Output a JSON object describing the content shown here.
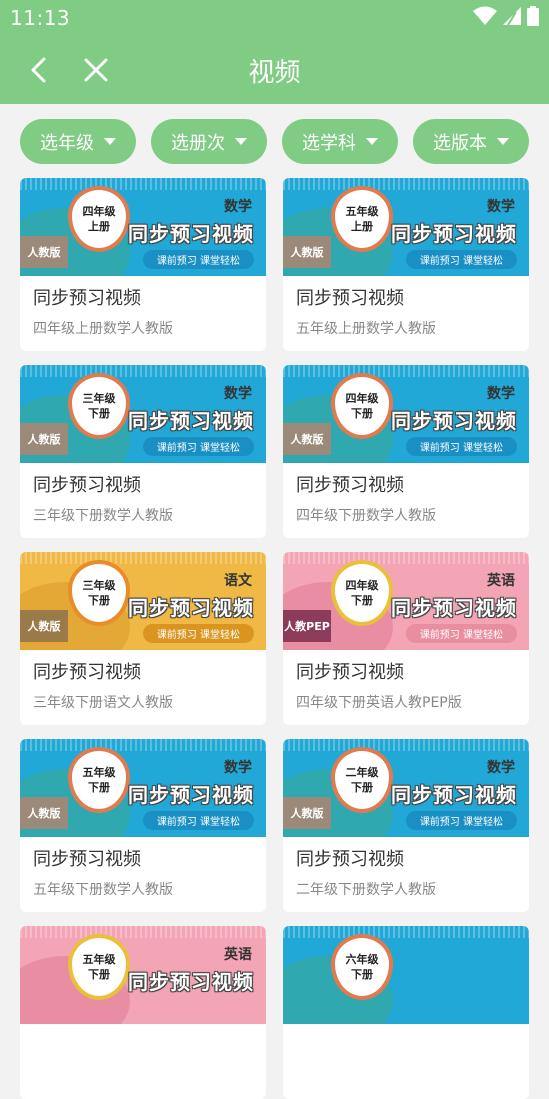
{
  "status": {
    "time": "11:13"
  },
  "header": {
    "title": "视频"
  },
  "filters": [
    {
      "label": "选年级"
    },
    {
      "label": "选册次"
    },
    {
      "label": "选学科"
    },
    {
      "label": "选版本"
    }
  ],
  "videos": [
    {
      "theme": "blue",
      "badge_line1": "四年级",
      "badge_line2": "上册",
      "subject": "数学",
      "headline": "同步预习视频",
      "slogan": "课前预习 课堂轻松",
      "edition": "人教版",
      "title": "同步预习视频",
      "subtitle": "四年级上册数学人教版"
    },
    {
      "theme": "blue",
      "badge_line1": "五年级",
      "badge_line2": "上册",
      "subject": "数学",
      "headline": "同步预习视频",
      "slogan": "课前预习 课堂轻松",
      "edition": "人教版",
      "title": "同步预习视频",
      "subtitle": "五年级上册数学人教版"
    },
    {
      "theme": "blue",
      "badge_line1": "三年级",
      "badge_line2": "下册",
      "subject": "数学",
      "headline": "同步预习视频",
      "slogan": "课前预习 课堂轻松",
      "edition": "人教版",
      "title": "同步预习视频",
      "subtitle": "三年级下册数学人教版"
    },
    {
      "theme": "blue",
      "badge_line1": "四年级",
      "badge_line2": "下册",
      "subject": "数学",
      "headline": "同步预习视频",
      "slogan": "课前预习 课堂轻松",
      "edition": "人教版",
      "title": "同步预习视频",
      "subtitle": "四年级下册数学人教版"
    },
    {
      "theme": "yellow",
      "badge_line1": "三年级",
      "badge_line2": "下册",
      "subject": "语文",
      "headline": "同步预习视频",
      "slogan": "课前预习 课堂轻松",
      "edition": "人教版",
      "title": "同步预习视频",
      "subtitle": "三年级下册语文人教版"
    },
    {
      "theme": "pink",
      "badge_line1": "四年级",
      "badge_line2": "下册",
      "subject": "英语",
      "headline": "同步预习视频",
      "slogan": "课前预习 课堂轻松",
      "edition": "人教PEP",
      "title": "同步预习视频",
      "subtitle": "四年级下册英语人教PEP版"
    },
    {
      "theme": "blue",
      "badge_line1": "五年级",
      "badge_line2": "下册",
      "subject": "数学",
      "headline": "同步预习视频",
      "slogan": "课前预习 课堂轻松",
      "edition": "人教版",
      "title": "同步预习视频",
      "subtitle": "五年级下册数学人教版"
    },
    {
      "theme": "blue",
      "badge_line1": "二年级",
      "badge_line2": "下册",
      "subject": "数学",
      "headline": "同步预习视频",
      "slogan": "课前预习 课堂轻松",
      "edition": "人教版",
      "title": "同步预习视频",
      "subtitle": "二年级下册数学人教版"
    },
    {
      "theme": "pink",
      "badge_line1": "五年级",
      "badge_line2": "下册",
      "subject": "英语",
      "headline": "同步预习视频",
      "slogan": "",
      "edition": "",
      "title": "",
      "subtitle": ""
    },
    {
      "theme": "blue",
      "badge_line1": "六年级",
      "badge_line2": "下册",
      "subject": "",
      "headline": "",
      "slogan": "",
      "edition": "",
      "title": "",
      "subtitle": ""
    }
  ],
  "colors": {
    "accent": "#80cc84",
    "background": "#f2f2f2"
  }
}
